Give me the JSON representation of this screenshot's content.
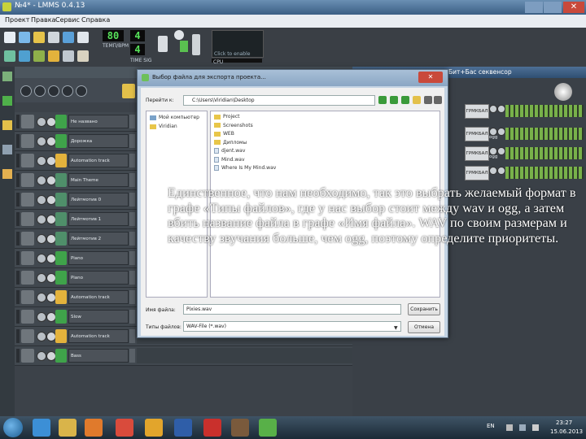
{
  "window": {
    "title": "№4* - LMMS 0.4.13"
  },
  "menu": {
    "items": [
      "Проект",
      "Правка",
      "Сервис",
      "Справка"
    ]
  },
  "toolbar": {
    "tempo_value": "80",
    "tempo_label": "ТЕМП/BPM",
    "timesig_num": "4",
    "timesig_den": "4",
    "timesig_label": "TIME SIG",
    "cpu_hint": "Click to enable",
    "cpu_label": "CPU"
  },
  "song_editor": {
    "tracks": [
      {
        "name": "Не названо",
        "type": "instrument",
        "icon_color": "#3fa34a"
      },
      {
        "name": "Дорожка",
        "type": "instrument",
        "icon_color": "#3fa34a"
      },
      {
        "name": "Automation track",
        "type": "automation",
        "icon_color": "#e3b23c"
      },
      {
        "name": "Main Theme",
        "type": "bb",
        "icon_color": "#4f8f6a"
      },
      {
        "name": "Лейтмотив 0",
        "type": "bb",
        "icon_color": "#4f8f6a"
      },
      {
        "name": "Лейтмотив 1",
        "type": "bb",
        "icon_color": "#4f8f6a"
      },
      {
        "name": "Лейтмотив 2",
        "type": "bb",
        "icon_color": "#4f8f6a"
      },
      {
        "name": "Piano",
        "type": "instrument",
        "icon_color": "#3fa34a"
      },
      {
        "name": "Piano",
        "type": "instrument",
        "icon_color": "#3fa34a"
      },
      {
        "name": "Automation track",
        "type": "automation",
        "icon_color": "#e3b23c"
      },
      {
        "name": "Slow",
        "type": "instrument",
        "icon_color": "#3fa34a"
      },
      {
        "name": "Automation track",
        "type": "automation",
        "icon_color": "#e3b23c"
      },
      {
        "name": "Bass",
        "type": "instrument",
        "icon_color": "#3fa34a"
      }
    ]
  },
  "bb_editor": {
    "title": "Бит+Бас секвенсор",
    "rows": [
      {
        "button": "ГРМКБАЛ",
        "extra": ""
      },
      {
        "button": "ГРМКБАЛ",
        "extra": "ogg"
      },
      {
        "button": "ГРМКБАЛ",
        "extra": "ogg"
      },
      {
        "button": "ГРМКБАЛ",
        "extra": ""
      }
    ]
  },
  "dialog": {
    "title": "Выбор файла для экспорта проекта...",
    "lookin_label": "Перейти к:",
    "lookin_path": "C:\\Users\\Viridian\\Desktop",
    "places": [
      {
        "label": "Мой компьютер",
        "icon": "computer-icon"
      },
      {
        "label": "Viridian",
        "icon": "folder-icon"
      }
    ],
    "files": [
      {
        "label": "Project",
        "icon": "folder-icon"
      },
      {
        "label": "Screenshots",
        "icon": "folder-icon"
      },
      {
        "label": "WEB",
        "icon": "folder-icon"
      },
      {
        "label": "Дипломы",
        "icon": "folder-icon"
      },
      {
        "label": "djent.wav",
        "icon": "file-icon"
      },
      {
        "label": "Mind.wav",
        "icon": "file-icon"
      },
      {
        "label": "Where Is My Mind.wav",
        "icon": "file-icon"
      }
    ],
    "filename_label": "Имя файла:",
    "filename_value": "Pixies.wav",
    "filetype_label": "Типы файлов:",
    "filetype_value": "WAV-File (*.wav)",
    "save_button": "Сохранить",
    "cancel_button": "Отмена"
  },
  "overlay_text": "Единственное, что нам необходимо, так это выбрать желаемый формат в графе «Типы файлов», где у нас выбор стоит между wav и ogg, а затем вбить название файла в графе «Имя файла». WAV по своим размерам и качеству звучания больше, чем ogg, поэтому определите приоритеты.",
  "taskbar": {
    "apps": [
      {
        "icon": "ie-icon",
        "color": "#3c8fd6"
      },
      {
        "icon": "explorer-icon",
        "color": "#d9b44a"
      },
      {
        "icon": "media-player-icon",
        "color": "#e07a2c"
      },
      {
        "icon": "chrome-icon",
        "color": "#d94b3c"
      },
      {
        "icon": "fl-studio-icon",
        "color": "#e2a52c"
      },
      {
        "icon": "word-icon",
        "color": "#2f5ea8"
      },
      {
        "icon": "app-red-icon",
        "color": "#c9302c"
      },
      {
        "icon": "app-stripes-icon",
        "color": "#7a5a3c"
      },
      {
        "icon": "lmms-icon",
        "color": "#58b048"
      }
    ],
    "lang": "EN",
    "time": "23:27",
    "date": "15.06.2013"
  }
}
